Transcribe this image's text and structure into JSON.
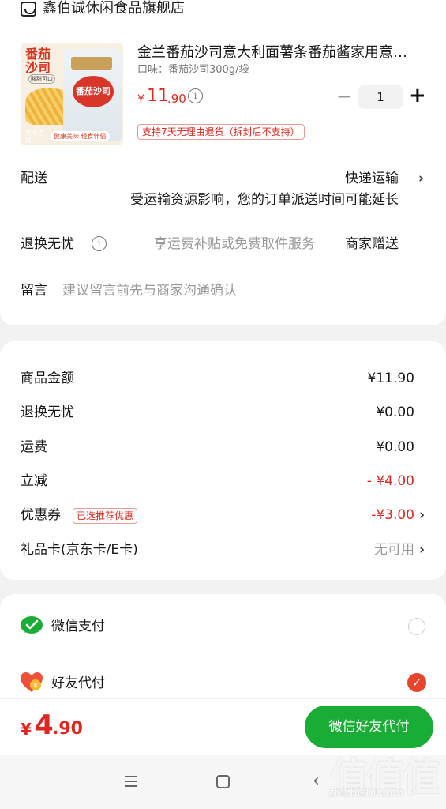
{
  "store": {
    "name": "鑫伯诚休闲食品旗舰店",
    "icon": "store-icon"
  },
  "product": {
    "title": "金兰番茄沙司意大利面薯条番茄酱家用意…",
    "spec": "口味：番茄沙司300g/袋",
    "price_symbol": "¥",
    "price_int": "11",
    "price_dec": ".90",
    "quantity": "1",
    "minus_label": "−",
    "plus_label": "+",
    "return_tag": "支持7天无理由退货（拆封后不支持）",
    "thumb": {
      "title": "番茄沙司",
      "subtitle": "酸甜可口",
      "bag_label": "番茄沙司",
      "badge_left": "美味百搭",
      "badge_right": "健康美味 轻食伴侣"
    }
  },
  "delivery": {
    "label": "配送",
    "value": "快递运输",
    "notice": "受运输资源影响，您的订单派送时间可能延长"
  },
  "worry_free": {
    "label": "退换无忧",
    "desc": "享运费补贴或免费取件服务",
    "value": "商家赠送"
  },
  "message": {
    "label": "留言",
    "placeholder": "建议留言前先与商家沟通确认"
  },
  "summary": {
    "goods_label": "商品金额",
    "goods_value": "¥11.90",
    "worry_label": "退换无忧",
    "worry_value": "¥0.00",
    "freight_label": "运费",
    "freight_value": "¥0.00",
    "discount_label": "立减",
    "discount_value": "- ¥4.00",
    "coupon_label": "优惠券",
    "coupon_tag": "已选推荐优惠",
    "coupon_value": "-¥3.00",
    "giftcard_label": "礼品卡(京东卡/E卡)",
    "giftcard_value": "无可用"
  },
  "payment": {
    "wechat_label": "微信支付",
    "friend_label": "好友代付",
    "friend_selected": true
  },
  "bottom": {
    "total_symbol": "¥",
    "total_int": "4",
    "total_dec": ".90",
    "pay_button": "微信好友代付"
  },
  "watermark": {
    "big": "值值值",
    "small": "zhizhizhi.com"
  },
  "colors": {
    "price_red": "#e0261d",
    "wechat_green": "#1aad35",
    "check_orange": "#e8432b"
  }
}
